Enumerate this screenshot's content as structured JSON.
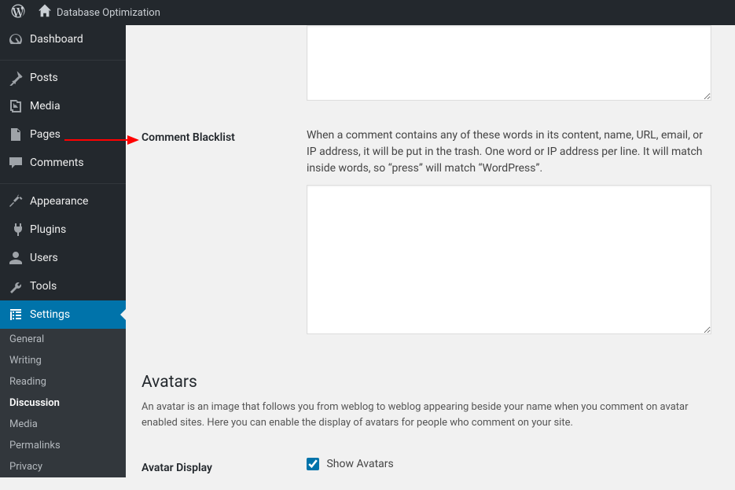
{
  "adminbar": {
    "site_title": "Database Optimization"
  },
  "sidebar": {
    "items": [
      {
        "label": "Dashboard"
      },
      {
        "label": "Posts"
      },
      {
        "label": "Media"
      },
      {
        "label": "Pages"
      },
      {
        "label": "Comments"
      },
      {
        "label": "Appearance"
      },
      {
        "label": "Plugins"
      },
      {
        "label": "Users"
      },
      {
        "label": "Tools"
      },
      {
        "label": "Settings"
      }
    ],
    "settings_submenu": [
      {
        "label": "General"
      },
      {
        "label": "Writing"
      },
      {
        "label": "Reading"
      },
      {
        "label": "Discussion"
      },
      {
        "label": "Media"
      },
      {
        "label": "Permalinks"
      },
      {
        "label": "Privacy"
      }
    ]
  },
  "content": {
    "moderation_value": "",
    "blacklist_label": "Comment Blacklist",
    "blacklist_desc": "When a comment contains any of these words in its content, name, URL, email, or IP address, it will be put in the trash. One word or IP address per line. It will match inside words, so “press” will match “WordPress”.",
    "blacklist_value": "",
    "avatars_heading": "Avatars",
    "avatars_desc": "An avatar is an image that follows you from weblog to weblog appearing beside your name when you comment on avatar enabled sites. Here you can enable the display of avatars for people who comment on your site.",
    "avatar_display_label": "Avatar Display",
    "show_avatars_label": "Show Avatars",
    "show_avatars_checked": true
  }
}
